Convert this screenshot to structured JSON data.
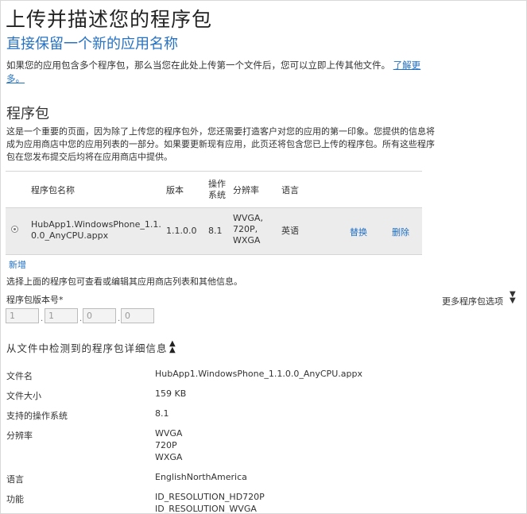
{
  "header": {
    "title": "上传并描述您的程序包",
    "subtitle": "直接保留一个新的应用名称",
    "intro_text": "如果您的应用包含多个程序包，那么当您在此处上传第一个文件后，您可以立即上传其他文件。",
    "learn_more": "了解更多。"
  },
  "packages": {
    "heading": "程序包",
    "description": "这是一个重要的页面，因为除了上传您的程序包外，您还需要打造客户对您的应用的第一印象。您提供的信息将成为应用商店中您的应用列表的一部分。如果要更新现有应用，此页还将包含您已上传的程序包。所有这些程序包在您发布提交后均将在应用商店中提供。",
    "columns": {
      "name": "程序包名称",
      "version": "版本",
      "os": "操作系统",
      "resolution": "分辨率",
      "language": "语言"
    },
    "row": {
      "name": "HubApp1.WindowsPhone_1.1.0.0_AnyCPU.appx",
      "version": "1.1.0.0",
      "os": "8.1",
      "resolution": "WVGA,\n720P,\nWXGA",
      "language": "英语",
      "replace": "替换",
      "delete": "删除"
    },
    "add_new": "新增",
    "select_note": "选择上面的程序包可查看或编辑其应用商店列表和其他信息。"
  },
  "version": {
    "label": "程序包版本号*",
    "more_options": "更多程序包选项",
    "fields": [
      "1",
      "1",
      "0",
      "0"
    ]
  },
  "details": {
    "heading": "从文件中检测到的程序包详细信息",
    "rows": [
      {
        "label": "文件名",
        "value": "HubApp1.WindowsPhone_1.1.0.0_AnyCPU.appx"
      },
      {
        "label": "文件大小",
        "value": "159 KB"
      },
      {
        "label": "支持的操作系统",
        "value": "8.1"
      },
      {
        "label": "分辨率",
        "value": "WVGA\n720P\nWXGA"
      },
      {
        "label": "语言",
        "value": "EnglishNorthAmerica"
      },
      {
        "label": "功能",
        "value": "ID_RESOLUTION_HD720P\nID_RESOLUTION_WVGA"
      }
    ]
  },
  "icons": {
    "more_options": "double-chevron-down-icon",
    "collapse_details": "double-chevron-up-icon"
  }
}
